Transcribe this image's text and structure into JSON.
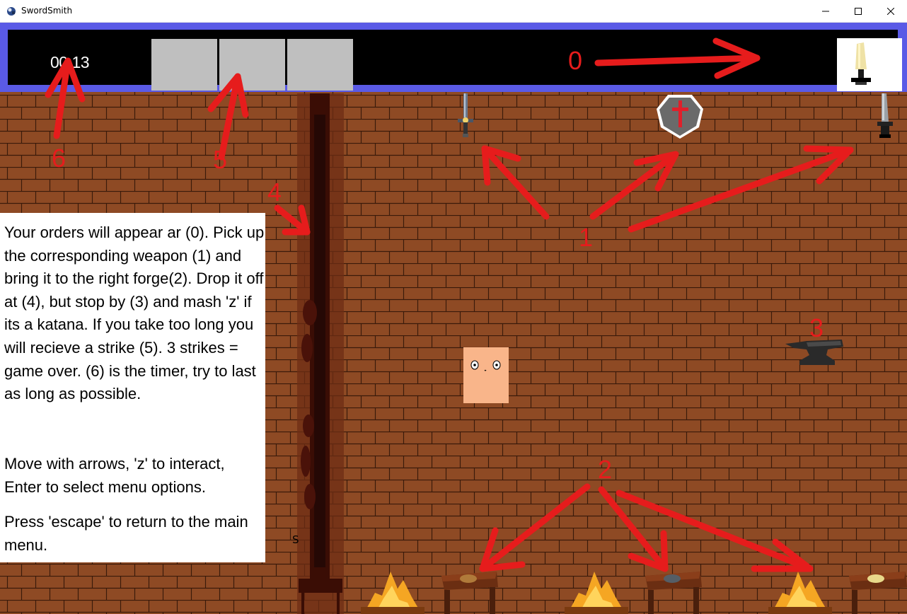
{
  "window": {
    "title": "SwordSmith",
    "app_icon": "swordsmith-app-icon",
    "controls": [
      "minimize-icon",
      "maximize-icon",
      "close-icon"
    ]
  },
  "hud": {
    "timer": "00:13",
    "strike_slots": 3,
    "strikes_filled": 0,
    "order_icon": "broadsword-icon",
    "colors": {
      "frame": "#5a5ae6",
      "panel": "#000000",
      "strike_slot": "#bfbfbf"
    }
  },
  "instructions": {
    "paragraph1": "Your orders will appear ar (0). Pick up the corresponding weapon (1) and bring it to the right forge(2). Drop it off at (4), but stop by (3) and mash 'z' if its a katana. If you take too long you will recieve a strike (5). 3 strikes = game over. (6) is the timer, try to last as long as possible.",
    "paragraph2": "Move with arrows, 'z' to interact, Enter to select menu options.",
    "paragraph3": "Press 'escape' to return to the main menu."
  },
  "annotations": {
    "n0": "0",
    "n1": "1",
    "n2": "2",
    "n3": "3",
    "n4": "4",
    "n5": "5",
    "n6": "6",
    "color": "#e61c1c"
  },
  "scene": {
    "dropoff_label": "S",
    "weapons": [
      "sword-icon",
      "shield-icon",
      "katana-icon"
    ],
    "anvil": "anvil-icon",
    "forges": [
      "forge-fire-icon",
      "forge-fire-icon",
      "forge-fire-icon"
    ],
    "tables": [
      "workbench-icon",
      "workbench-icon",
      "workbench-icon"
    ],
    "floor_color": "#8e4a24",
    "mortar_color": "#3a1a0a"
  }
}
